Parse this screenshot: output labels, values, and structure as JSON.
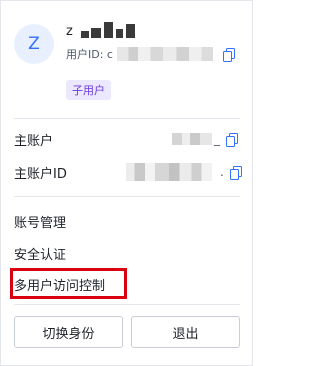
{
  "profile": {
    "avatar_letter": "Z",
    "name_prefix": "z",
    "uid_label": "用户ID: c",
    "role_badge": "子用户"
  },
  "account": {
    "main_account_label": "主账户",
    "main_account_trail": "_",
    "main_account_id_label": "主账户ID",
    "main_account_id_trail": "."
  },
  "menu": {
    "items": [
      {
        "label": "账号管理"
      },
      {
        "label": "安全认证"
      },
      {
        "label": "多用户访问控制"
      }
    ]
  },
  "actions": {
    "switch_identity": "切换身份",
    "logout": "退出"
  },
  "colors": {
    "accent": "#3370ff",
    "badge_bg": "#ece8ff",
    "badge_text": "#6a3be0",
    "highlight": "#d9000f"
  }
}
